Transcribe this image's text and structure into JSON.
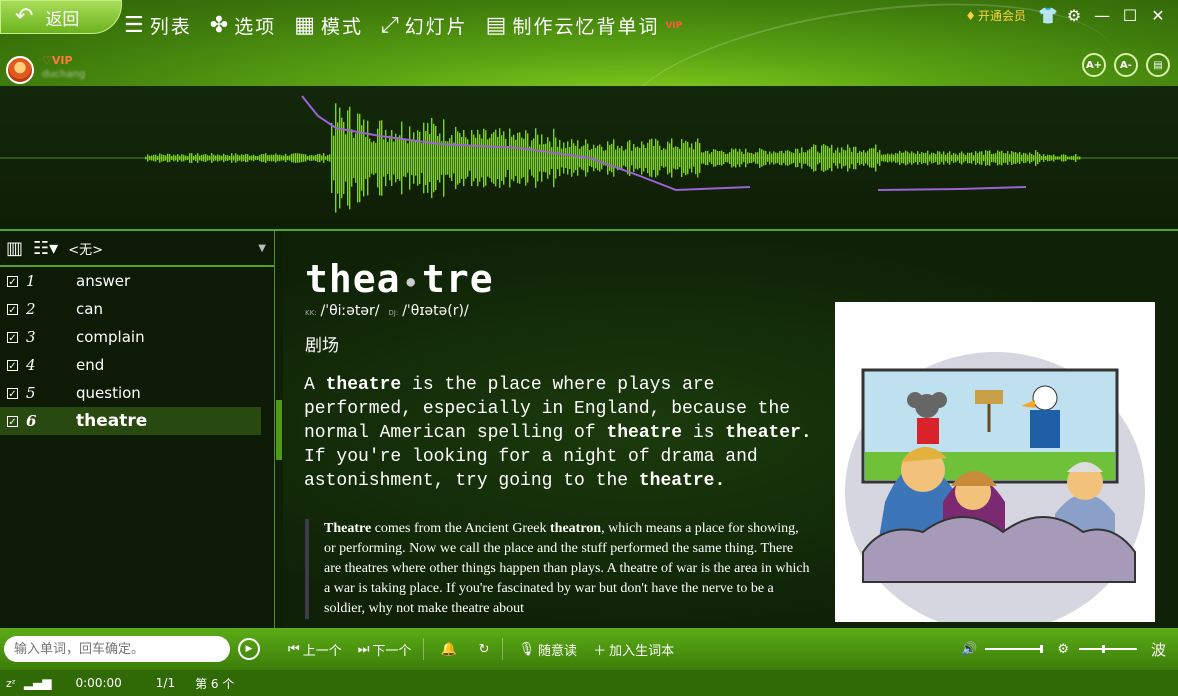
{
  "topbar": {
    "back_label": "返回",
    "menu": [
      {
        "icon": "list-icon",
        "label": "列表"
      },
      {
        "icon": "clover-icon",
        "label": "选项"
      },
      {
        "icon": "grid-icon",
        "label": "模式"
      },
      {
        "icon": "slideshow-icon",
        "label": "幻灯片"
      },
      {
        "icon": "document-icon",
        "label": "制作云忆背单词",
        "badge": "VIP"
      }
    ],
    "open_vip": "开通会员",
    "user": {
      "vip": "VIP",
      "name": "duchang"
    },
    "font_buttons": [
      "A+",
      "A-"
    ]
  },
  "word_list": {
    "dropdown_value": "<无>",
    "items": [
      {
        "num": "1",
        "word": "answer",
        "checked": true
      },
      {
        "num": "2",
        "word": "can",
        "checked": true
      },
      {
        "num": "3",
        "word": "complain",
        "checked": true
      },
      {
        "num": "4",
        "word": "end",
        "checked": true
      },
      {
        "num": "5",
        "word": "question",
        "checked": true
      },
      {
        "num": "6",
        "word": "theatre",
        "checked": true,
        "active": true
      }
    ]
  },
  "entry": {
    "syllable_1": "thea",
    "syllable_2": "tre",
    "kk_label": "KK:",
    "kk": "/ˈθiːətər/",
    "dj_label": "DJ:",
    "dj": "/ˈθɪətə(r)/",
    "gloss": "剧场",
    "definition": [
      {
        "t": "A "
      },
      {
        "t": "theatre",
        "b": true
      },
      {
        "t": " is the place where plays are performed, especially in England, because the normal American spelling of "
      },
      {
        "t": "theatre",
        "b": true
      },
      {
        "t": " is "
      },
      {
        "t": "theater.",
        "b": true
      },
      {
        "t": " If you're looking for a night of drama and astonishment, try going to the "
      },
      {
        "t": "theatre.",
        "b": true
      }
    ],
    "etymology": [
      {
        "t": "Theatre",
        "b": true
      },
      {
        "t": " comes from the Ancient Greek "
      },
      {
        "t": "theatron",
        "b": true
      },
      {
        "t": ", which means a place for showing, or performing. Now we call the place and the stuff performed the same thing. There are theatres where other things happen than plays. A theatre of war is the area in which a war is taking place. If you're fascinated by war but don't have the nerve to be a soldier, why not make theatre about"
      }
    ]
  },
  "bottombar": {
    "search_placeholder": "输入单词，回车确定。",
    "prev": "上一个",
    "next": "下一个",
    "read": "随意读",
    "add_vocab": "加入生词本",
    "wave_label": "波"
  },
  "statusbar": {
    "time": "0:00:00",
    "page": "1/1",
    "count": "第 6 个"
  },
  "colors": {
    "accent": "#5cac16",
    "wave": "#7ed321",
    "pitch": "#9a63d6"
  }
}
